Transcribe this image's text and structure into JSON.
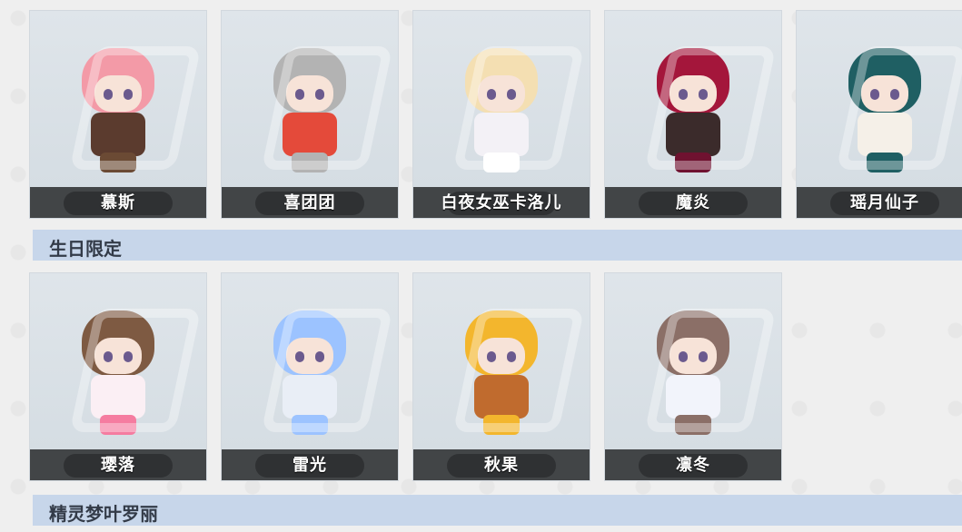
{
  "sections": [
    {
      "title": "生日限定"
    },
    {
      "title": "精灵梦叶罗丽"
    }
  ],
  "row1": [
    {
      "name": "慕斯",
      "hair": "#f39aa7",
      "outfit": "#5b3b2e",
      "hat": "#6b4a34"
    },
    {
      "name": "喜团团",
      "hair": "#b3b3b3",
      "outfit": "#e44a3a",
      "hat": "#b3b3b3"
    },
    {
      "name": "白夜女巫卡洛儿",
      "hair": "#f4dfb2",
      "outfit": "#f3f1f6",
      "hat": "#ffffff"
    },
    {
      "name": "魔炎",
      "hair": "#a4163b",
      "outfit": "#3b2b2b",
      "hat": "#6f1230"
    },
    {
      "name": "瑶月仙子",
      "hair": "#1f5f63",
      "outfit": "#f5f0e8",
      "hat": "#1f5f63"
    }
  ],
  "row2": [
    {
      "name": "璎落",
      "hair": "#7e5a42",
      "outfit": "#fbeff4",
      "hat": "#f57ca0"
    },
    {
      "name": "雷光",
      "hair": "#9cc3ff",
      "outfit": "#e9eef6",
      "hat": "#9cc3ff"
    },
    {
      "name": "秋果",
      "hair": "#f3b62d",
      "outfit": "#c06b2e",
      "hat": "#f3b62d"
    },
    {
      "name": "凛冬",
      "hair": "#8b6f67",
      "outfit": "#f2f4fb",
      "hat": "#8b6f67"
    }
  ]
}
